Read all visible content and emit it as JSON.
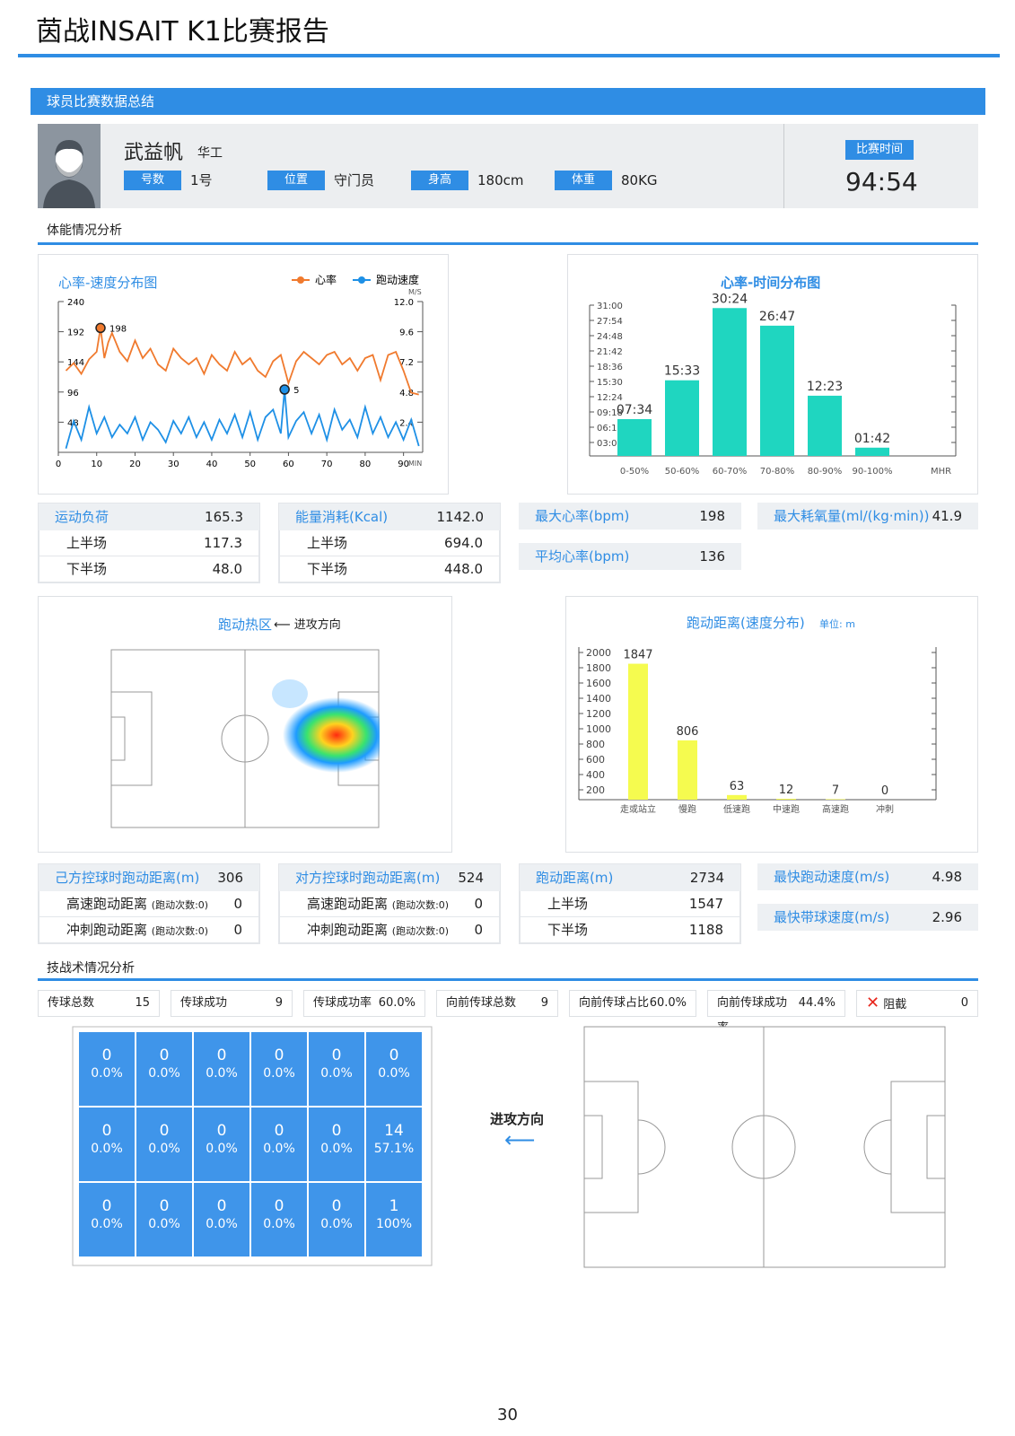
{
  "header": {
    "title": "茵战INSAIT K1比赛报告"
  },
  "summary_bar": {
    "label": "球员比赛数据总结"
  },
  "player": {
    "name": "武益帆",
    "org": "华工",
    "fields": [
      {
        "label": "号数",
        "value": "1号"
      },
      {
        "label": "位置",
        "value": "守门员"
      },
      {
        "label": "身高",
        "value": "180cm"
      },
      {
        "label": "体重",
        "value": "80KG"
      }
    ],
    "match_time_label": "比赛时间",
    "match_time": "94:54"
  },
  "sections": {
    "physical": "体能情况分析",
    "tactical": "技战术情况分析"
  },
  "hr_speed_chart": {
    "title": "心率-速度分布图",
    "legend_hr": "心率",
    "legend_speed": "跑动速度",
    "right_unit": "M/S",
    "x_unit": "MIN",
    "left_ticks": [
      "240",
      "192",
      "144",
      "96",
      "48"
    ],
    "right_ticks": [
      "12.0",
      "9.6",
      "7.2",
      "4.8",
      "2.4"
    ],
    "x_ticks": [
      "0",
      "10",
      "20",
      "30",
      "40",
      "50",
      "60",
      "70",
      "80",
      "90"
    ],
    "hr_peak_label": "198",
    "speed_peak_label": "5",
    "colors": {
      "hr": "#f07a2e",
      "speed": "#1e90e6"
    }
  },
  "chart_data": [
    {
      "type": "line",
      "title": "心率-速度分布图",
      "xlabel": "MIN",
      "xlim": [
        0,
        95
      ],
      "series": [
        {
          "name": "心率",
          "axis": "left",
          "ylim": [
            0,
            240
          ],
          "x": [
            2,
            4,
            6,
            8,
            10,
            11,
            12,
            13,
            14,
            16,
            18,
            20,
            22,
            24,
            26,
            28,
            30,
            32,
            34,
            36,
            38,
            40,
            42,
            44,
            46,
            48,
            50,
            52,
            54,
            56,
            58,
            60,
            62,
            64,
            66,
            68,
            70,
            72,
            74,
            76,
            78,
            80,
            82,
            84,
            86,
            88,
            90,
            92,
            94
          ],
          "values": [
            130,
            142,
            125,
            148,
            160,
            198,
            150,
            175,
            190,
            160,
            145,
            178,
            150,
            165,
            140,
            130,
            165,
            150,
            140,
            150,
            125,
            155,
            140,
            130,
            160,
            140,
            150,
            130,
            120,
            145,
            155,
            110,
            145,
            160,
            150,
            140,
            155,
            160,
            140,
            150,
            130,
            150,
            155,
            115,
            155,
            160,
            130,
            95,
            92
          ]
        },
        {
          "name": "跑动速度",
          "axis": "right",
          "ylim": [
            0,
            12
          ],
          "x": [
            2,
            4,
            6,
            8,
            10,
            12,
            14,
            16,
            18,
            20,
            22,
            24,
            26,
            28,
            30,
            32,
            34,
            36,
            38,
            40,
            42,
            44,
            46,
            48,
            50,
            52,
            54,
            56,
            58,
            59,
            60,
            62,
            64,
            66,
            68,
            70,
            72,
            74,
            76,
            78,
            80,
            82,
            84,
            86,
            88,
            90,
            92,
            94
          ],
          "values": [
            0.3,
            2.5,
            1.0,
            3.6,
            1.5,
            2.8,
            1.2,
            2.2,
            1.5,
            2.8,
            1.0,
            2.4,
            1.8,
            0.8,
            2.5,
            1.5,
            2.8,
            1.2,
            2.4,
            1.0,
            2.6,
            1.5,
            3.0,
            1.2,
            3.2,
            1.0,
            2.8,
            3.4,
            1.5,
            5.0,
            1.2,
            2.5,
            3.2,
            1.5,
            3.0,
            1.0,
            3.4,
            1.8,
            2.6,
            1.2,
            3.6,
            1.5,
            2.8,
            1.2,
            2.4,
            1.0,
            2.6,
            0.5
          ]
        }
      ],
      "peaks": {
        "hr": 198,
        "speed": 5
      }
    },
    {
      "type": "bar",
      "title": "心率-时间分布图",
      "categories": [
        "0-50%",
        "50-60%",
        "60-70%",
        "70-80%",
        "80-90%",
        "90-100%"
      ],
      "values": [
        7.57,
        15.55,
        30.4,
        26.78,
        12.38,
        1.7
      ],
      "value_labels": [
        "07:34",
        "15:33",
        "30:24",
        "26:47",
        "12:23",
        "01:42"
      ],
      "y_ticks": [
        "31:00",
        "27:54",
        "24:48",
        "21:42",
        "18:36",
        "15:30",
        "12:24",
        "09:18",
        "06:12",
        "03:06"
      ],
      "xlabel": "MHR",
      "ylim": [
        0,
        31
      ],
      "color": "#1fd6c0"
    },
    {
      "type": "bar",
      "title": "跑动距离(速度分布)",
      "unit": "单位: m",
      "categories": [
        "走或站立",
        "慢跑",
        "低速跑",
        "中速跑",
        "高速跑",
        "冲刺"
      ],
      "values": [
        1847,
        806,
        63,
        12,
        7,
        0
      ],
      "y_ticks": [
        "2000",
        "1800",
        "1600",
        "1400",
        "1200",
        "1000",
        "800",
        "600",
        "400",
        "200"
      ],
      "ylim": [
        0,
        2000
      ],
      "color": "#f5fb4f"
    }
  ],
  "load_stats": {
    "head_label": "运动负荷",
    "head_value": "165.3",
    "rows": [
      {
        "label": "上半场",
        "value": "117.3"
      },
      {
        "label": "下半场",
        "value": "48.0"
      }
    ]
  },
  "energy_stats": {
    "head_label": "能量消耗(Kcal)",
    "head_value": "1142.0",
    "rows": [
      {
        "label": "上半场",
        "value": "694.0"
      },
      {
        "label": "下半场",
        "value": "448.0"
      }
    ]
  },
  "hr_stats": {
    "max_label": "最大心率(bpm)",
    "max_value": "198",
    "avg_label": "平均心率(bpm)",
    "avg_value": "136"
  },
  "vo2_stats": {
    "label": "最大耗氧量(ml/(kg·min))",
    "value": "41.9"
  },
  "heatmap": {
    "title": "跑动热区",
    "direction": "⟵ 进攻方向"
  },
  "own_ball_dist": {
    "head_label": "己方控球时跑动距离(m)",
    "head_value": "306",
    "rows": [
      {
        "label": "高速跑动距离",
        "sub": "(跑动次数:0)",
        "value": "0"
      },
      {
        "label": "冲刺跑动距离",
        "sub": "(跑动次数:0)",
        "value": "0"
      }
    ]
  },
  "opp_ball_dist": {
    "head_label": "对方控球时跑动距离(m)",
    "head_value": "524",
    "rows": [
      {
        "label": "高速跑动距离",
        "sub": "(跑动次数:0)",
        "value": "0"
      },
      {
        "label": "冲刺跑动距离",
        "sub": "(跑动次数:0)",
        "value": "0"
      }
    ]
  },
  "run_dist": {
    "head_label": "跑动距离(m)",
    "head_value": "2734",
    "rows": [
      {
        "label": "上半场",
        "value": "1547"
      },
      {
        "label": "下半场",
        "value": "1188"
      }
    ]
  },
  "speed_stats": {
    "run_label": "最快跑动速度(m/s)",
    "run_value": "4.98",
    "dribble_label": "最快带球速度(m/s)",
    "dribble_value": "2.96"
  },
  "pass_stats": [
    {
      "label": "传球总数",
      "value": "15"
    },
    {
      "label": "传球成功",
      "value": "9"
    },
    {
      "label": "传球成功率",
      "value": "60.0%"
    },
    {
      "label": "向前传球总数",
      "value": "9"
    },
    {
      "label": "向前传球占比",
      "value": "60.0%"
    },
    {
      "label": "向前传球成功率",
      "value": "44.4%"
    },
    {
      "label": "阻截",
      "value": "0"
    }
  ],
  "pass_grid": {
    "direction_label": "进攻方向",
    "arrow": "⟵",
    "cells": [
      [
        {
          "n": "0",
          "p": "0.0%"
        },
        {
          "n": "0",
          "p": "0.0%"
        },
        {
          "n": "0",
          "p": "0.0%"
        },
        {
          "n": "0",
          "p": "0.0%"
        },
        {
          "n": "0",
          "p": "0.0%"
        },
        {
          "n": "0",
          "p": "0.0%"
        }
      ],
      [
        {
          "n": "0",
          "p": "0.0%"
        },
        {
          "n": "0",
          "p": "0.0%"
        },
        {
          "n": "0",
          "p": "0.0%"
        },
        {
          "n": "0",
          "p": "0.0%"
        },
        {
          "n": "0",
          "p": "0.0%"
        },
        {
          "n": "14",
          "p": "57.1%"
        }
      ],
      [
        {
          "n": "0",
          "p": "0.0%"
        },
        {
          "n": "0",
          "p": "0.0%"
        },
        {
          "n": "0",
          "p": "0.0%"
        },
        {
          "n": "0",
          "p": "0.0%"
        },
        {
          "n": "0",
          "p": "0.0%"
        },
        {
          "n": "1",
          "p": "100%"
        }
      ]
    ]
  },
  "page_number": "30",
  "colors": {
    "accent": "#2f8de4",
    "hr": "#f07a2e",
    "speed": "#1e90e6",
    "teal": "#1fd6c0",
    "yellow": "#f5fb4f",
    "cell": "#3f95ea"
  }
}
